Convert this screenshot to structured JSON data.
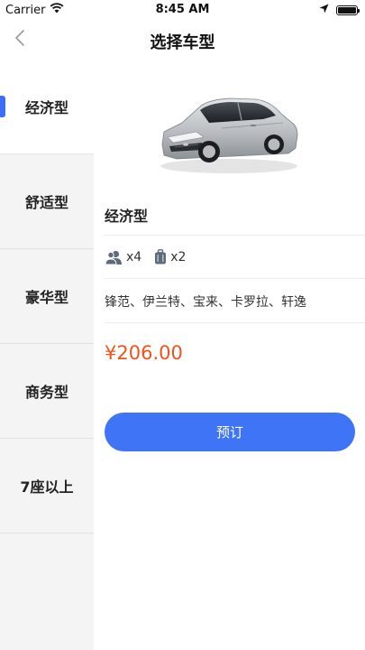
{
  "status_bar": {
    "carrier": "Carrier",
    "time": "8:45 AM"
  },
  "nav": {
    "title": "选择车型"
  },
  "sidebar": {
    "items": [
      {
        "label": "经济型",
        "active": true
      },
      {
        "label": "舒适型",
        "active": false
      },
      {
        "label": "豪华型",
        "active": false
      },
      {
        "label": "商务型",
        "active": false
      },
      {
        "label": "7座以上",
        "active": false
      }
    ]
  },
  "car": {
    "name": "经济型",
    "passengers": "x4",
    "luggage": "x2",
    "models": "锋范、伊兰特、宝来、卡罗拉、轩逸",
    "price": "¥206.00"
  },
  "actions": {
    "book_label": "预订"
  },
  "colors": {
    "accent": "#3f74f6",
    "price": "#f0531c",
    "sidebar_bg": "#f4f4f4"
  }
}
